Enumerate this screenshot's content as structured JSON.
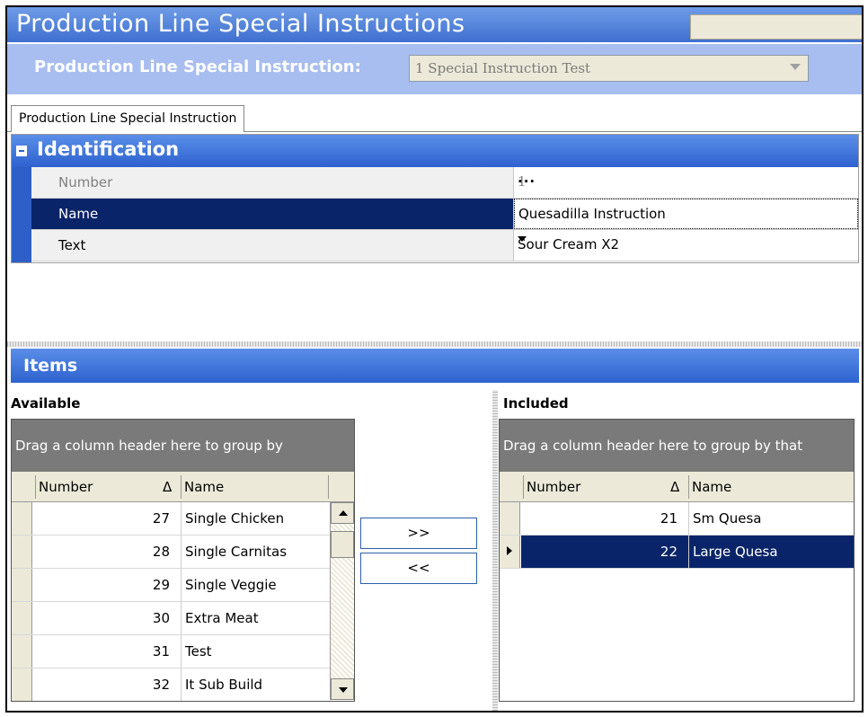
{
  "window": {
    "title": "Production Line Special Instructions"
  },
  "selector": {
    "label": "Production Line Special Instruction:",
    "value": "1 Special Instruction Test"
  },
  "tab": {
    "label": "Production Line Special Instruction"
  },
  "identification": {
    "title": "Identification",
    "rows": [
      {
        "name": "Number",
        "value": "1"
      },
      {
        "name": "Name",
        "value": "Quesadilla Instruction"
      },
      {
        "name": "Text",
        "value": "Sour Cream X2"
      }
    ]
  },
  "items": {
    "title": "Items",
    "available": {
      "label": "Available",
      "group_by": "Drag a column header here to group by",
      "columns": [
        "Number",
        "Δ",
        "Name"
      ],
      "rows": [
        {
          "number": "27",
          "name": "Single Chicken"
        },
        {
          "number": "28",
          "name": "Single Carnitas"
        },
        {
          "number": "29",
          "name": "Single Veggie"
        },
        {
          "number": "30",
          "name": "Extra Meat"
        },
        {
          "number": "31",
          "name": "Test"
        },
        {
          "number": "32",
          "name": "It Sub Build"
        }
      ]
    },
    "included": {
      "label": "Included",
      "group_by": "Drag a column header here to group by that",
      "columns": [
        "Number",
        "Δ",
        "Name"
      ],
      "rows": [
        {
          "number": "21",
          "name": "Sm Quesa"
        },
        {
          "number": "22",
          "name": "Large Quesa"
        }
      ]
    },
    "buttons": {
      "add": ">>",
      "remove": "<<"
    }
  }
}
